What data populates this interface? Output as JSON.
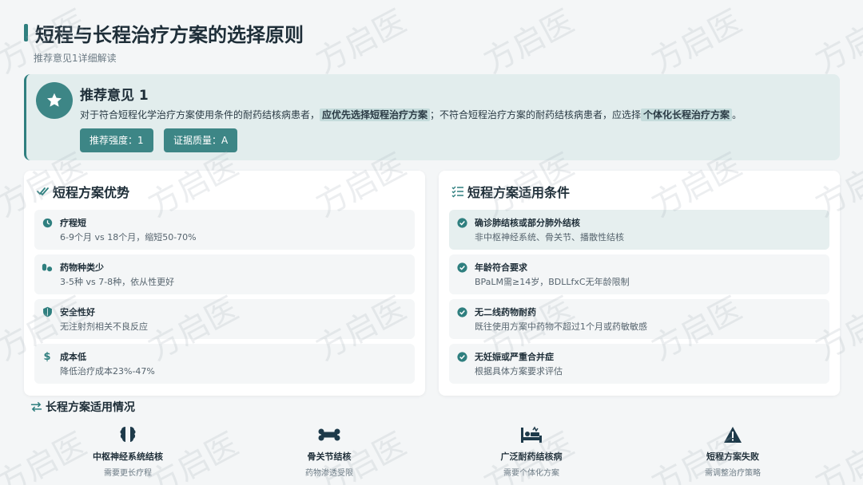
{
  "header": {
    "title": "短程与长程治疗方案的选择原则",
    "subtitle": "推荐意见1详细解读"
  },
  "recommendation": {
    "title": "推荐意见 1",
    "text_part1": "对于符合短程化学治疗方案使用条件的耐药结核病患者，",
    "highlight1": "应优先选择短程治疗方案",
    "text_part2": "；不符合短程治疗方案的耐药结核病患者，应选择",
    "highlight2": "个体化长程治疗方案",
    "text_part3": "。",
    "badge_strength": "推荐强度：1",
    "badge_evidence": "证据质量：A",
    "icon": "star-icon"
  },
  "advantages": {
    "title": "短程方案优势",
    "items": [
      {
        "title": "疗程短",
        "desc": "6-9个月 vs 18个月，缩短50-70%",
        "icon": "clock-icon"
      },
      {
        "title": "药物种类少",
        "desc": "3-5种 vs 7-8种，依从性更好",
        "icon": "pills-icon"
      },
      {
        "title": "安全性好",
        "desc": "无注射剂相关不良反应",
        "icon": "shield-icon"
      },
      {
        "title": "成本低",
        "desc": "降低治疗成本23%-47%",
        "icon": "dollar-icon"
      }
    ]
  },
  "conditions": {
    "title": "短程方案适用条件",
    "items": [
      {
        "title": "确诊肺结核或部分肺外结核",
        "desc": "非中枢神经系统、骨关节、播散性结核"
      },
      {
        "title": "年龄符合要求",
        "desc": "BPaLM需≥14岁，BDLLfxC无年龄限制"
      },
      {
        "title": "无二线药物耐药",
        "desc": "既往使用方案中药物不超过1个月或药敏敏感"
      },
      {
        "title": "无妊娠或严重合并症",
        "desc": "根据具体方案要求评估"
      }
    ]
  },
  "long_course": {
    "title": "长程方案适用情况",
    "items": [
      {
        "title": "中枢神经系统结核",
        "desc": "需要更长疗程",
        "icon": "brain-icon"
      },
      {
        "title": "骨关节结核",
        "desc": "药物渗透受限",
        "icon": "bone-icon"
      },
      {
        "title": "广泛耐药结核病",
        "desc": "需要个体化方案",
        "icon": "bed-icon"
      },
      {
        "title": "短程方案失败",
        "desc": "需调整治疗策略",
        "icon": "warning-icon"
      }
    ]
  },
  "watermark_text": "方启医",
  "colors": {
    "accent": "#2f7f7f",
    "accent_light": "#e2eded",
    "badge": "#3d8686"
  }
}
